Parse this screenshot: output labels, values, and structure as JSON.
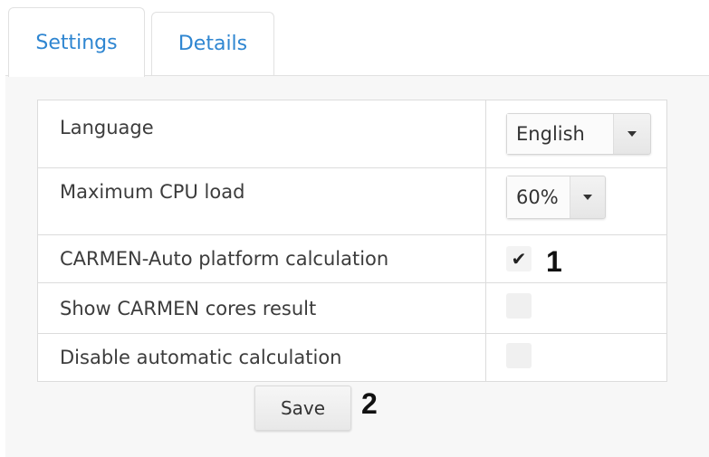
{
  "tabs": [
    {
      "label": "Settings",
      "active": true
    },
    {
      "label": "Details",
      "active": false
    }
  ],
  "settings": {
    "language": {
      "label": "Language",
      "value": "English"
    },
    "cpu_load": {
      "label": "Maximum CPU load",
      "value": "60%"
    },
    "auto_platform": {
      "label": "CARMEN-Auto platform calculation",
      "checked": true,
      "check_glyph": "✔"
    },
    "show_cores": {
      "label": "Show CARMEN cores result",
      "checked": false
    },
    "disable_auto": {
      "label": "Disable automatic calculation",
      "checked": false
    }
  },
  "callouts": {
    "one": "1",
    "two": "2"
  },
  "save_label": "Save",
  "colors": {
    "tab_text": "#2f86d1",
    "panel_bg": "#f7f7f7",
    "border": "#dcdcdc"
  }
}
